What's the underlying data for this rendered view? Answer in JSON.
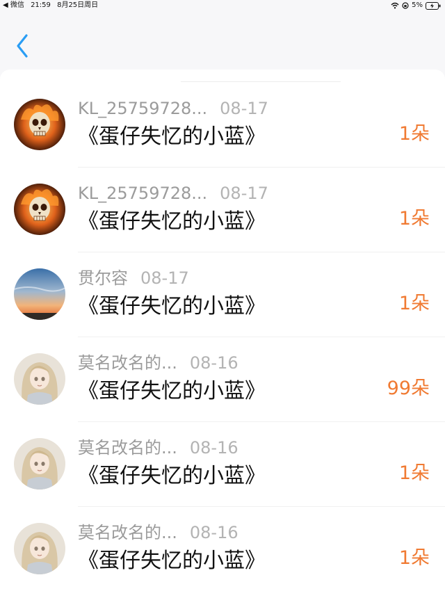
{
  "status_bar": {
    "back_app": "◀ 微信",
    "time": "21:59",
    "date": "8月25日周日",
    "battery": "5%"
  },
  "nav": {
    "back_icon": "chevron-left-icon"
  },
  "gift_list": [
    {
      "username": "KL_25759728...",
      "date": "08-17",
      "title": "《蛋仔失忆的小蓝》",
      "amount": "1朵",
      "avatar": "flaming-skull"
    },
    {
      "username": "KL_25759728...",
      "date": "08-17",
      "title": "《蛋仔失忆的小蓝》",
      "amount": "1朵",
      "avatar": "flaming-skull"
    },
    {
      "username": "贯尔容",
      "date": "08-17",
      "title": "《蛋仔失忆的小蓝》",
      "amount": "1朵",
      "avatar": "sunset-sky"
    },
    {
      "username": "莫名改名的...",
      "date": "08-16",
      "title": "《蛋仔失忆的小蓝》",
      "amount": "99朵",
      "avatar": "anime-girl"
    },
    {
      "username": "莫名改名的...",
      "date": "08-16",
      "title": "《蛋仔失忆的小蓝》",
      "amount": "1朵",
      "avatar": "anime-girl"
    },
    {
      "username": "莫名改名的...",
      "date": "08-16",
      "title": "《蛋仔失忆的小蓝》",
      "amount": "1朵",
      "avatar": "anime-girl"
    }
  ],
  "colors": {
    "accent_blue": "#2a9df4",
    "gift_orange": "#f07a32"
  }
}
